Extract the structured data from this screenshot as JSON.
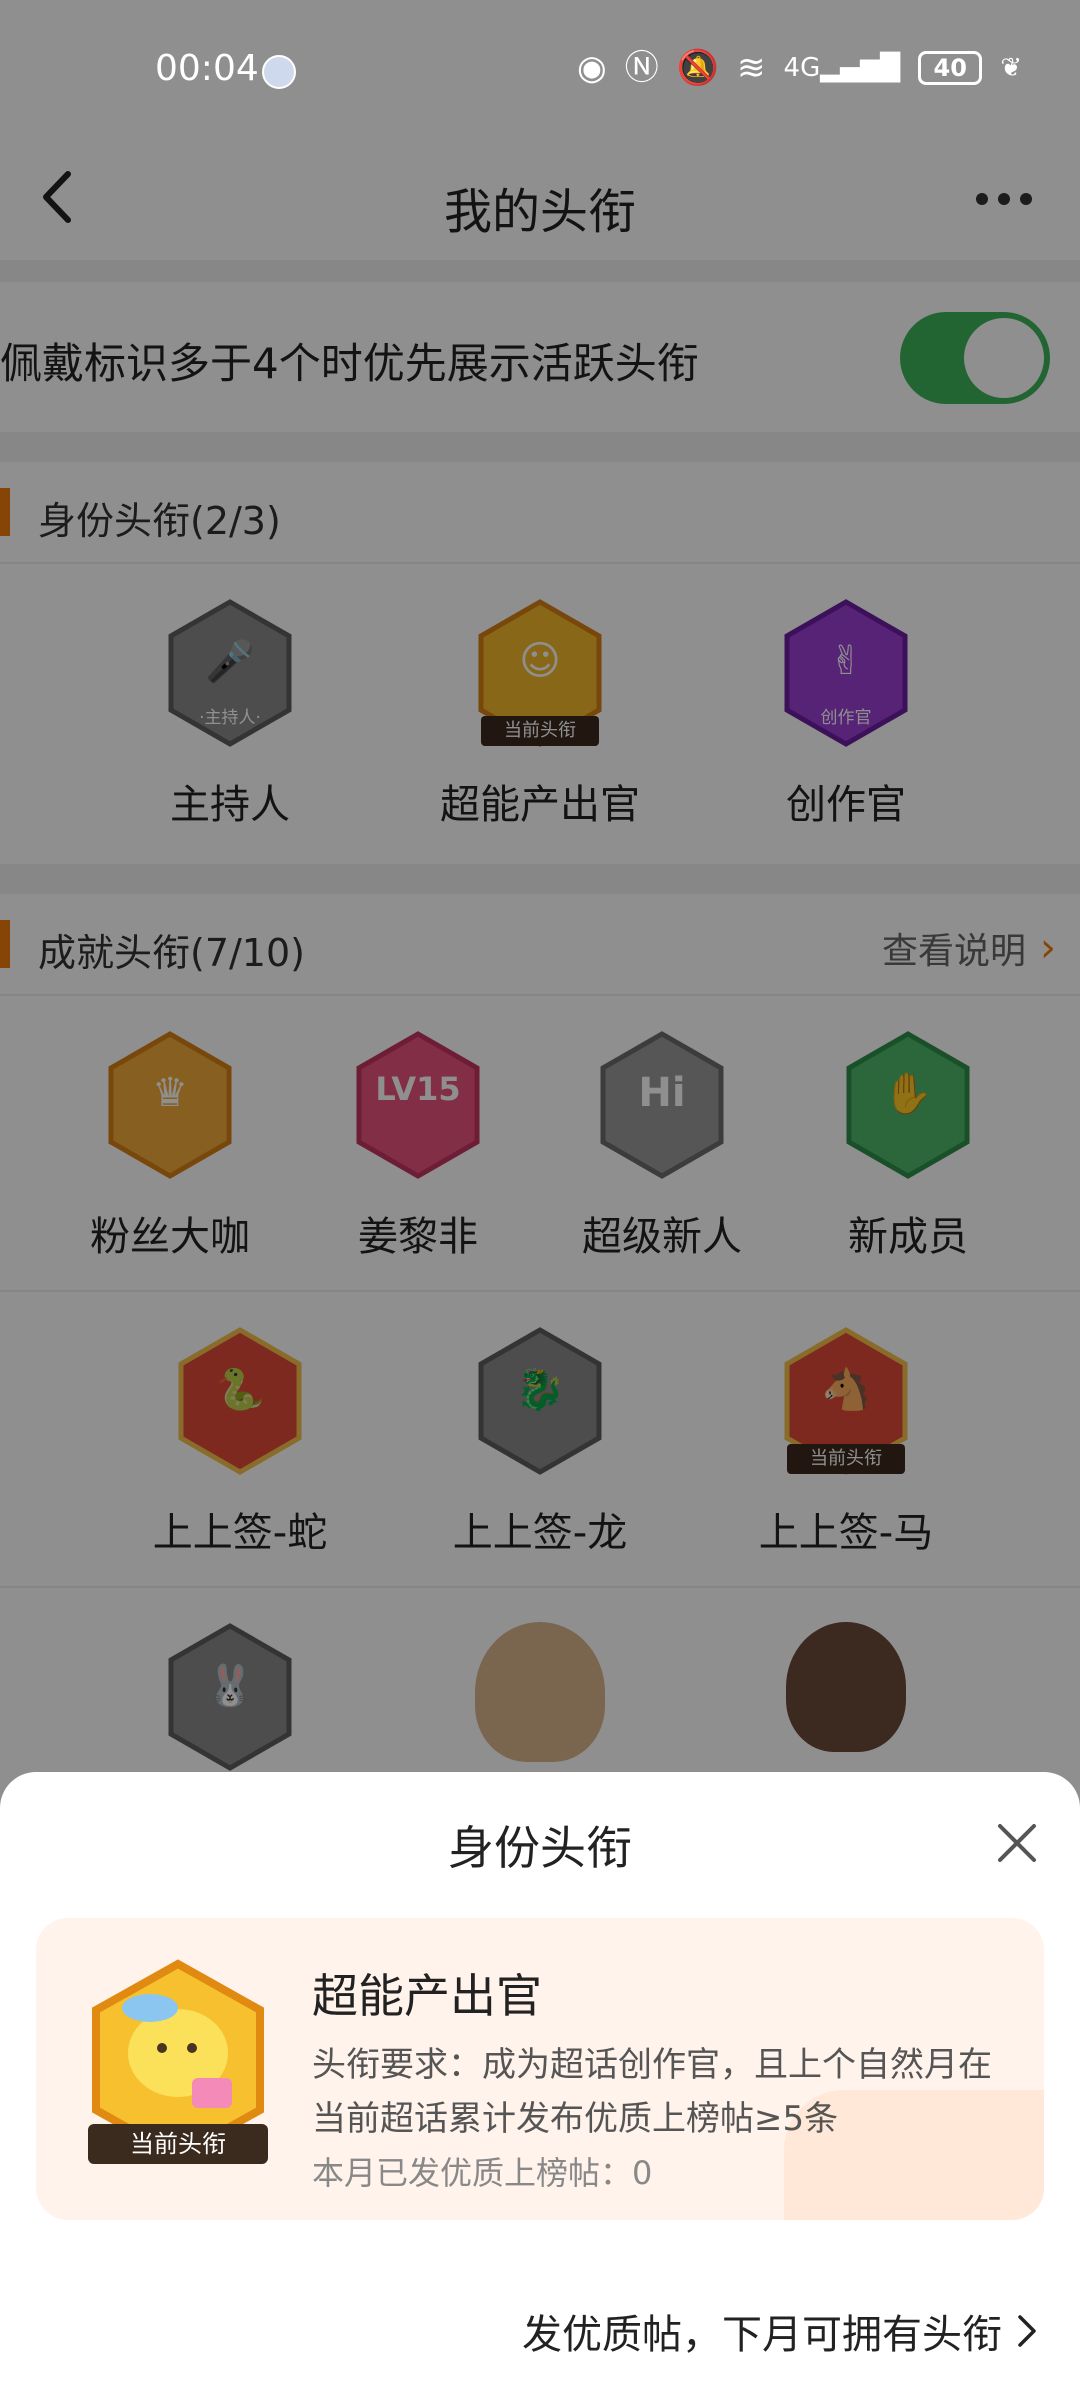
{
  "status_bar": {
    "time": "00:04",
    "battery": "40"
  },
  "nav": {
    "title": "我的头衔"
  },
  "toggle": {
    "label": "佩戴标识多于4个时优先展示活跃头衔",
    "on": true
  },
  "identity_section": {
    "title": "身份头衔(2/3)",
    "badges": [
      {
        "name": "主持人",
        "tag": "·主持人·",
        "color": "#8a8a8a"
      },
      {
        "name": "超能产出官",
        "ribbon": "当前头衔",
        "color": "#f2b92c"
      },
      {
        "name": "创作官",
        "tag": "创作官",
        "color": "#9b3fd2"
      }
    ]
  },
  "achievement_section": {
    "title": "成就头衔(7/10)",
    "link": "查看说明",
    "row1": [
      {
        "name": "粉丝大咖",
        "mark": "♛",
        "color": "#f0a93a"
      },
      {
        "name": "姜黎非",
        "mark": "LV15",
        "color": "#e9527f"
      },
      {
        "name": "超级新人",
        "mark": "Hi",
        "color": "#9a9a9a"
      },
      {
        "name": "新成员",
        "mark": "✋",
        "color": "#4db86a"
      }
    ],
    "row2": [
      {
        "name": "上上签-蛇",
        "color": "#e04a3a"
      },
      {
        "name": "上上签-龙",
        "color": "#8a8a8a"
      },
      {
        "name": "上上签-马",
        "ribbon": "当前头衔",
        "color": "#e04a3a"
      }
    ]
  },
  "sheet": {
    "title": "身份头衔",
    "badge_ribbon": "当前头衔",
    "card_title": "超能产出官",
    "requirement": "头衔要求：成为超话创作官，且上个自然月在当前超话累计发布优质上榜帖≥5条",
    "monthly_stat": "本月已发优质上榜帖：0",
    "cta": "发优质帖，下月可拥有头衔"
  }
}
